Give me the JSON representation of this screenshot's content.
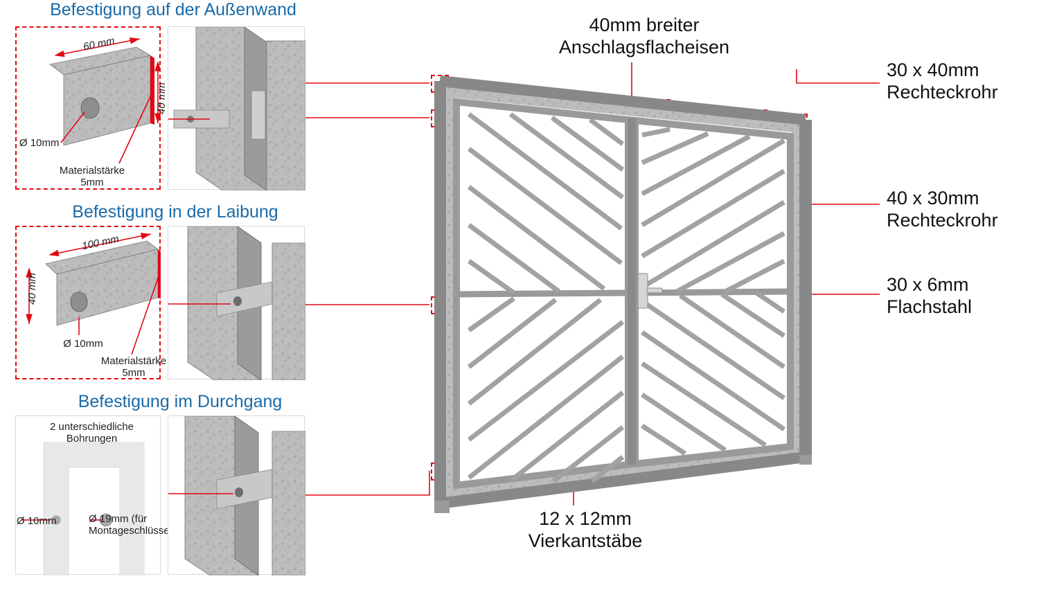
{
  "left": {
    "section1": {
      "title": "Befestigung auf der Außenwand",
      "dim60": "60 mm",
      "dim40": "40 mm",
      "hole": "Ø 10mm",
      "thickness_l1": "Materialstärke",
      "thickness_l2": "5mm"
    },
    "section2": {
      "title": "Befestigung in der Laibung",
      "dim100": "100 mm",
      "dim40": "40 mm",
      "hole": "Ø 10mm",
      "thickness_l1": "Materialstärke",
      "thickness_l2": "5mm"
    },
    "section3": {
      "title": "Befestigung im Durchgang",
      "note": "2 unterschiedliche Bohrungen",
      "hole1": "Ø 10mm",
      "hole2_l1": "Ø 19mm (für",
      "hole2_l2": "Montageschlüssel)"
    }
  },
  "callouts": {
    "top_center_l1": "40mm breiter",
    "top_center_l2": "Anschlagsflacheisen",
    "right1_l1": "30 x 40mm",
    "right1_l2": "Rechteckrohr",
    "right2_l1": "40 x 30mm",
    "right2_l2": "Rechteckrohr",
    "right3_l1": "30 x 6mm",
    "right3_l2": "Flachstahl",
    "bottom_l1": "12 x 12mm",
    "bottom_l2": "Vierkantstäbe"
  }
}
